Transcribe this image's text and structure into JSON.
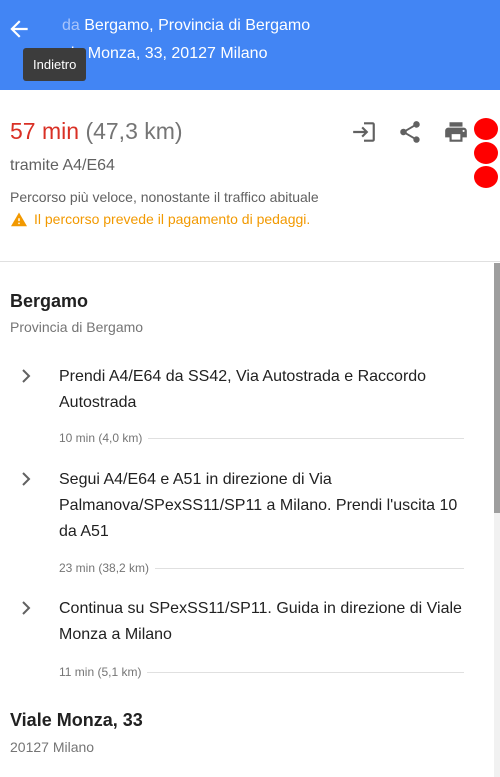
{
  "header": {
    "from_prefix": "da",
    "from_text": "Bergamo, Provincia di Bergamo",
    "to_text": "ale Monza, 33, 20127 Milano",
    "tooltip": "Indietro"
  },
  "summary": {
    "time": "57 min",
    "distance": "(47,3 km)",
    "via": "tramite A4/E64",
    "note": "Percorso più veloce, nonostante il traffico abituale",
    "warning": "Il percorso prevede il pagamento di pedaggi.",
    "warning_color": "#f29900",
    "time_color": "#d93025",
    "actions": [
      "send-to-device-icon",
      "share-icon",
      "print-icon"
    ]
  },
  "origin": {
    "title": "Bergamo",
    "subtitle": "Provincia di Bergamo"
  },
  "steps": [
    {
      "text": "Prendi A4/E64 da SS42, Via Autostrada e Raccordo Autostrada",
      "meta": "10 min (4,0 km)"
    },
    {
      "text": "Segui A4/E64 e A51 in direzione di Via Palmanova/SPexSS11/SP11 a Milano. Prendi l'uscita 10 da A51",
      "meta": "23 min (38,2 km)"
    },
    {
      "text": "Continua su SPexSS11/SP11. Guida in direzione di Viale Monza a Milano",
      "meta": "11 min (5,1 km)"
    }
  ],
  "destination": {
    "title": "Viale Monza, 33",
    "subtitle": "20127 Milano"
  },
  "colors": {
    "header_bg": "#4285f4"
  }
}
